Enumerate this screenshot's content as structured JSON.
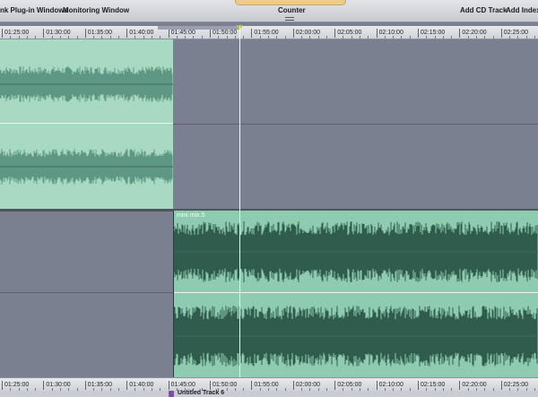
{
  "toolbar": {
    "link_plugins": "nk Plug-in Windows",
    "monitoring_window": "Monitoring Window",
    "counter": "Counter",
    "add_cd_track": "Add CD Track",
    "add_index": "Add Index M"
  },
  "ruler": {
    "labels": [
      "01:25:00",
      "01:30:00",
      "01:35:00",
      "01:40:00",
      "01:45:00",
      "01:50:00",
      "01:55:00",
      "02:00:00",
      "02:05:00",
      "02:10:00",
      "02:15:00",
      "02:20:00",
      "02:25:00"
    ]
  },
  "clips": {
    "upper": {
      "name": ""
    },
    "lower": {
      "name": "mini mix.5"
    }
  },
  "status": {
    "track_name": "Untitled Track 6"
  },
  "colors": {
    "clip_fill": "#8fcbb1",
    "waveform": "#2f5c4c",
    "track_bg": "#7b8090",
    "playhead": "#f5f5f5"
  }
}
